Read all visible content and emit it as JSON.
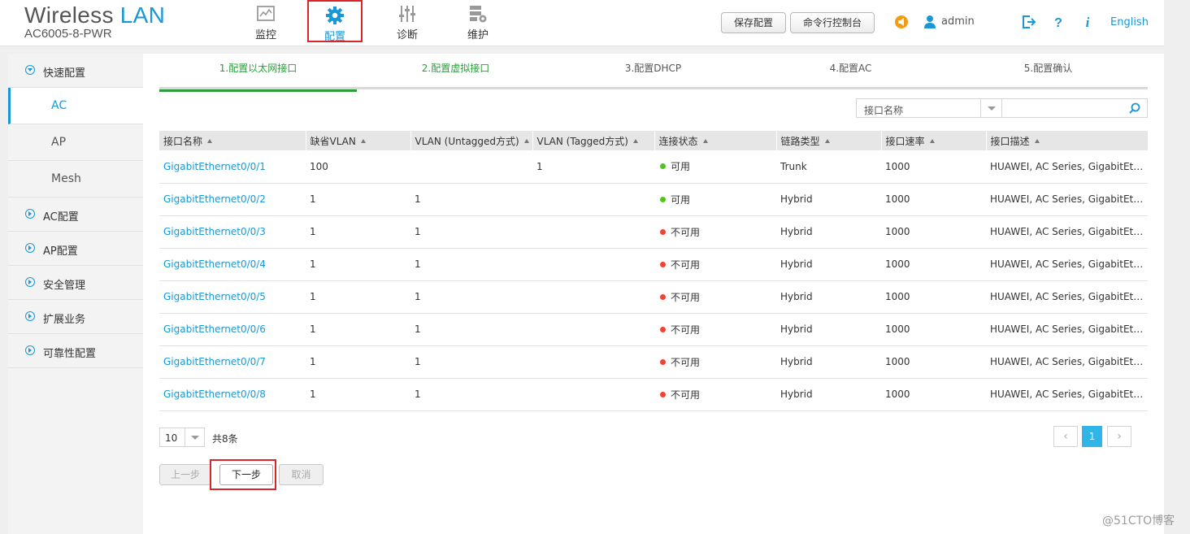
{
  "header": {
    "brand_title_main": "Wireless",
    "brand_title_accent": "LAN",
    "model": "AC6005-8-PWR",
    "nav": [
      {
        "label": "监控",
        "icon": "monitor-icon"
      },
      {
        "label": "配置",
        "icon": "gear-icon",
        "active": true
      },
      {
        "label": "诊断",
        "icon": "sliders-icon"
      },
      {
        "label": "维护",
        "icon": "server-gear-icon"
      }
    ],
    "save_config": "保存配置",
    "cli_console": "命令行控制台",
    "username": "admin",
    "language": "English"
  },
  "sidebar": {
    "items": [
      {
        "label": "快速配置",
        "expanded": true
      },
      {
        "label": "AC",
        "sub": true,
        "active": true
      },
      {
        "label": "AP",
        "sub": true
      },
      {
        "label": "Mesh",
        "sub": true
      },
      {
        "label": "AC配置"
      },
      {
        "label": "AP配置"
      },
      {
        "label": "安全管理"
      },
      {
        "label": "扩展业务"
      },
      {
        "label": "可靠性配置"
      }
    ]
  },
  "steps": [
    {
      "label": "1.配置以太网接口",
      "state": "current"
    },
    {
      "label": "2.配置虚拟接口",
      "state": "done"
    },
    {
      "label": "3.配置DHCP",
      "state": "todo"
    },
    {
      "label": "4.配置AC",
      "state": "todo"
    },
    {
      "label": "5.配置确认",
      "state": "todo"
    }
  ],
  "search": {
    "field_label": "接口名称",
    "value": ""
  },
  "table": {
    "columns": [
      "接口名称",
      "缺省VLAN",
      "VLAN (Untagged方式)",
      "VLAN (Tagged方式)",
      "连接状态",
      "链路类型",
      "接口速率",
      "接口描述"
    ],
    "rows": [
      [
        "GigabitEthernet0/0/1",
        "100",
        "",
        "1",
        "可用",
        "Trunk",
        "1000",
        "HUAWEI, AC Series, GigabitEth..."
      ],
      [
        "GigabitEthernet0/0/2",
        "1",
        "1",
        "",
        "可用",
        "Hybrid",
        "1000",
        "HUAWEI, AC Series, GigabitEth..."
      ],
      [
        "GigabitEthernet0/0/3",
        "1",
        "1",
        "",
        "不可用",
        "Hybrid",
        "1000",
        "HUAWEI, AC Series, GigabitEth..."
      ],
      [
        "GigabitEthernet0/0/4",
        "1",
        "1",
        "",
        "不可用",
        "Hybrid",
        "1000",
        "HUAWEI, AC Series, GigabitEth..."
      ],
      [
        "GigabitEthernet0/0/5",
        "1",
        "1",
        "",
        "不可用",
        "Hybrid",
        "1000",
        "HUAWEI, AC Series, GigabitEth..."
      ],
      [
        "GigabitEthernet0/0/6",
        "1",
        "1",
        "",
        "不可用",
        "Hybrid",
        "1000",
        "HUAWEI, AC Series, GigabitEth..."
      ],
      [
        "GigabitEthernet0/0/7",
        "1",
        "1",
        "",
        "不可用",
        "Hybrid",
        "1000",
        "HUAWEI, AC Series, GigabitEth..."
      ],
      [
        "GigabitEthernet0/0/8",
        "1",
        "1",
        "",
        "不可用",
        "Hybrid",
        "1000",
        "HUAWEI, AC Series, GigabitEth..."
      ]
    ],
    "status_colors": {
      "可用": "#52c41a",
      "不可用": "#f04134"
    }
  },
  "pager": {
    "page_size": "10",
    "total": "共8条",
    "current_page": "1",
    "prev": "‹",
    "next": "›"
  },
  "actions": {
    "prev_step": "上一步",
    "next_step": "下一步",
    "cancel": "取消"
  },
  "watermark": "@51CTO博客",
  "colors": {
    "accent": "#1a98d5",
    "step_done": "#2d9c3c",
    "highlight": "#d9262c"
  }
}
